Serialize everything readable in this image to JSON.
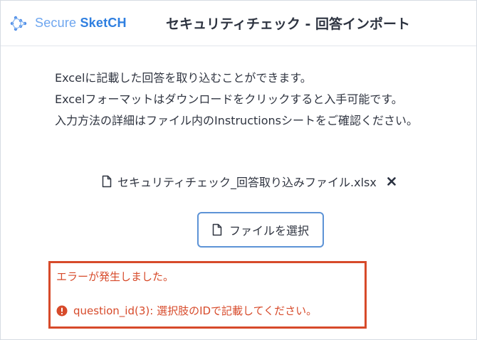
{
  "header": {
    "logo": {
      "secure": "Secure",
      "sketch": "SketCH",
      "icon": "network-logo-icon"
    },
    "title": "セキュリティチェック - 回答インポート"
  },
  "description": {
    "lines": [
      "Excelに記載した回答を取り込むことができます。",
      "Excelフォーマットはダウンロードをクリックすると入手可能です。",
      "入力方法の詳細はファイル内のInstructionsシートをご確認ください。"
    ]
  },
  "file": {
    "name": "セキュリティチェック_回答取り込みファイル.xlsx",
    "icon": "document-icon",
    "remove_icon": "close-icon"
  },
  "select_button": {
    "label": "ファイルを選択",
    "icon": "document-icon"
  },
  "error": {
    "title": "エラーが発生しました。",
    "message": "question_id(3): 選択肢のIDで記載してください。",
    "icon": "alert-circle-icon"
  },
  "colors": {
    "logo_secure": "#6ea6ef",
    "logo_sketch": "#2f7fe0",
    "button_border": "#5d93d6",
    "error": "#d74a2a",
    "text": "#2f3440"
  }
}
